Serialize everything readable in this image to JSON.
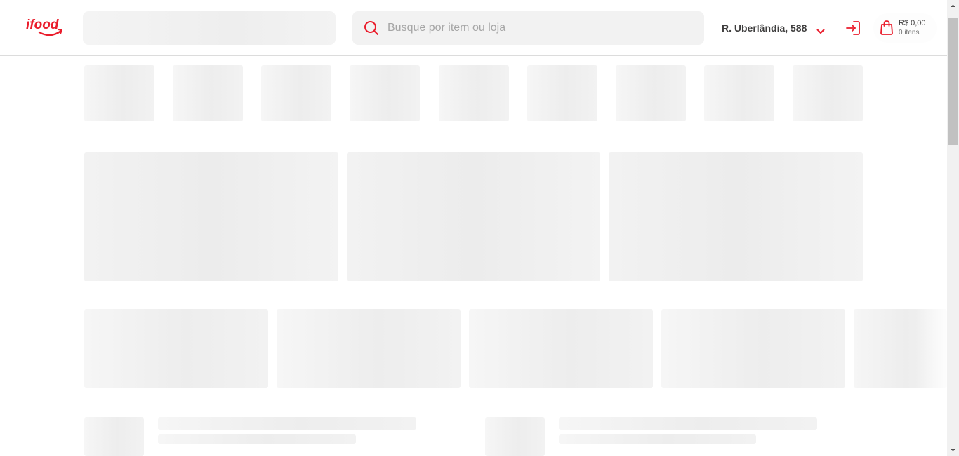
{
  "header": {
    "logo_text": "ifood",
    "search": {
      "placeholder": "Busque por item ou loja",
      "value": ""
    },
    "address": "R. Uberlândia, 588",
    "cart": {
      "price": "R$ 0,00",
      "items": "0 itens"
    }
  },
  "icons": {
    "logo": "ifood-logo",
    "search": "search-icon",
    "address_dropdown": "chevron-down-icon",
    "login": "login-icon",
    "cart": "shopping-bag-icon"
  },
  "colors": {
    "brand": "#ea1d2c",
    "text": "#3f3e3e",
    "skeleton": "#f2f2f2"
  },
  "loading_state": "skeleton placeholders"
}
